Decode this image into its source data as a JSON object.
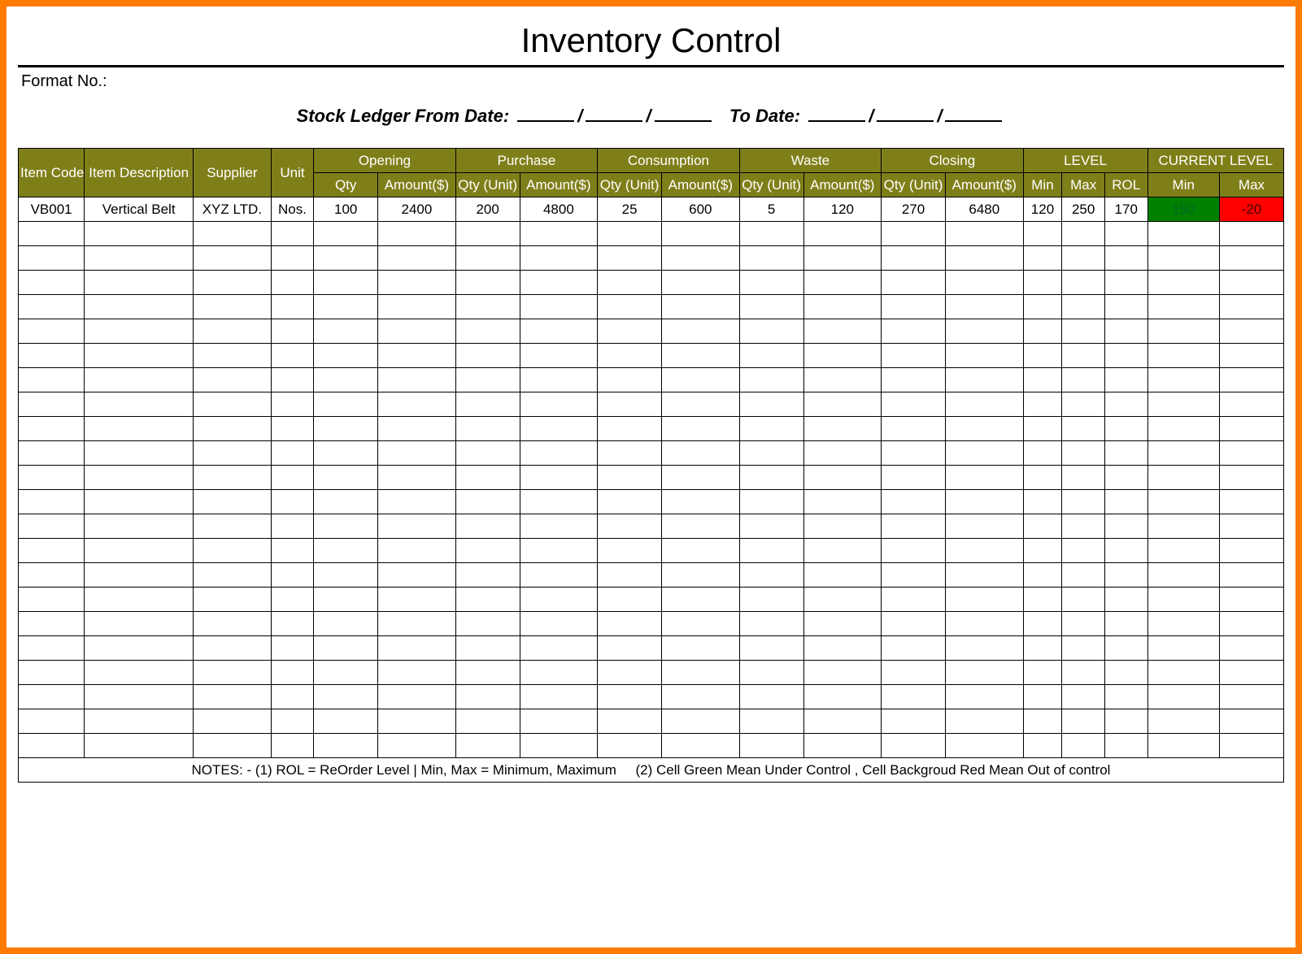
{
  "title": "Inventory Control",
  "format_label": "Format No.:",
  "ledger_label_from": "Stock Ledger From Date:",
  "ledger_label_to": "To Date:",
  "headers": {
    "item_code": "Item Code",
    "item_desc": "Item Description",
    "supplier": "Supplier",
    "unit": "Unit",
    "opening": "Opening",
    "purchase": "Purchase",
    "consumption": "Consumption",
    "waste": "Waste",
    "closing": "Closing",
    "level": "LEVEL",
    "current_level": "CURRENT LEVEL",
    "qty": "Qty",
    "amount": "Amount($)",
    "qty_unit": "Qty (Unit)",
    "min": "Min",
    "max": "Max",
    "rol": "ROL"
  },
  "rows": [
    {
      "code": "VB001",
      "desc": "Vertical Belt",
      "supplier": "XYZ LTD.",
      "unit": "Nos.",
      "open_qty": "100",
      "open_amt": "2400",
      "pur_qty": "200",
      "pur_amt": "4800",
      "con_qty": "25",
      "con_amt": "600",
      "waste_qty": "5",
      "waste_amt": "120",
      "close_qty": "270",
      "close_amt": "6480",
      "lvl_min": "120",
      "lvl_max": "250",
      "lvl_rol": "170",
      "cur_min": "150",
      "cur_max": "-20",
      "cur_min_class": "green-cell",
      "cur_max_class": "red-cell"
    }
  ],
  "empty_rows": 22,
  "notes": "NOTES: - (1) ROL = ReOrder Level | Min, Max = Minimum, Maximum     (2) Cell Green Mean Under Control , Cell Backgroud Red Mean Out of control"
}
